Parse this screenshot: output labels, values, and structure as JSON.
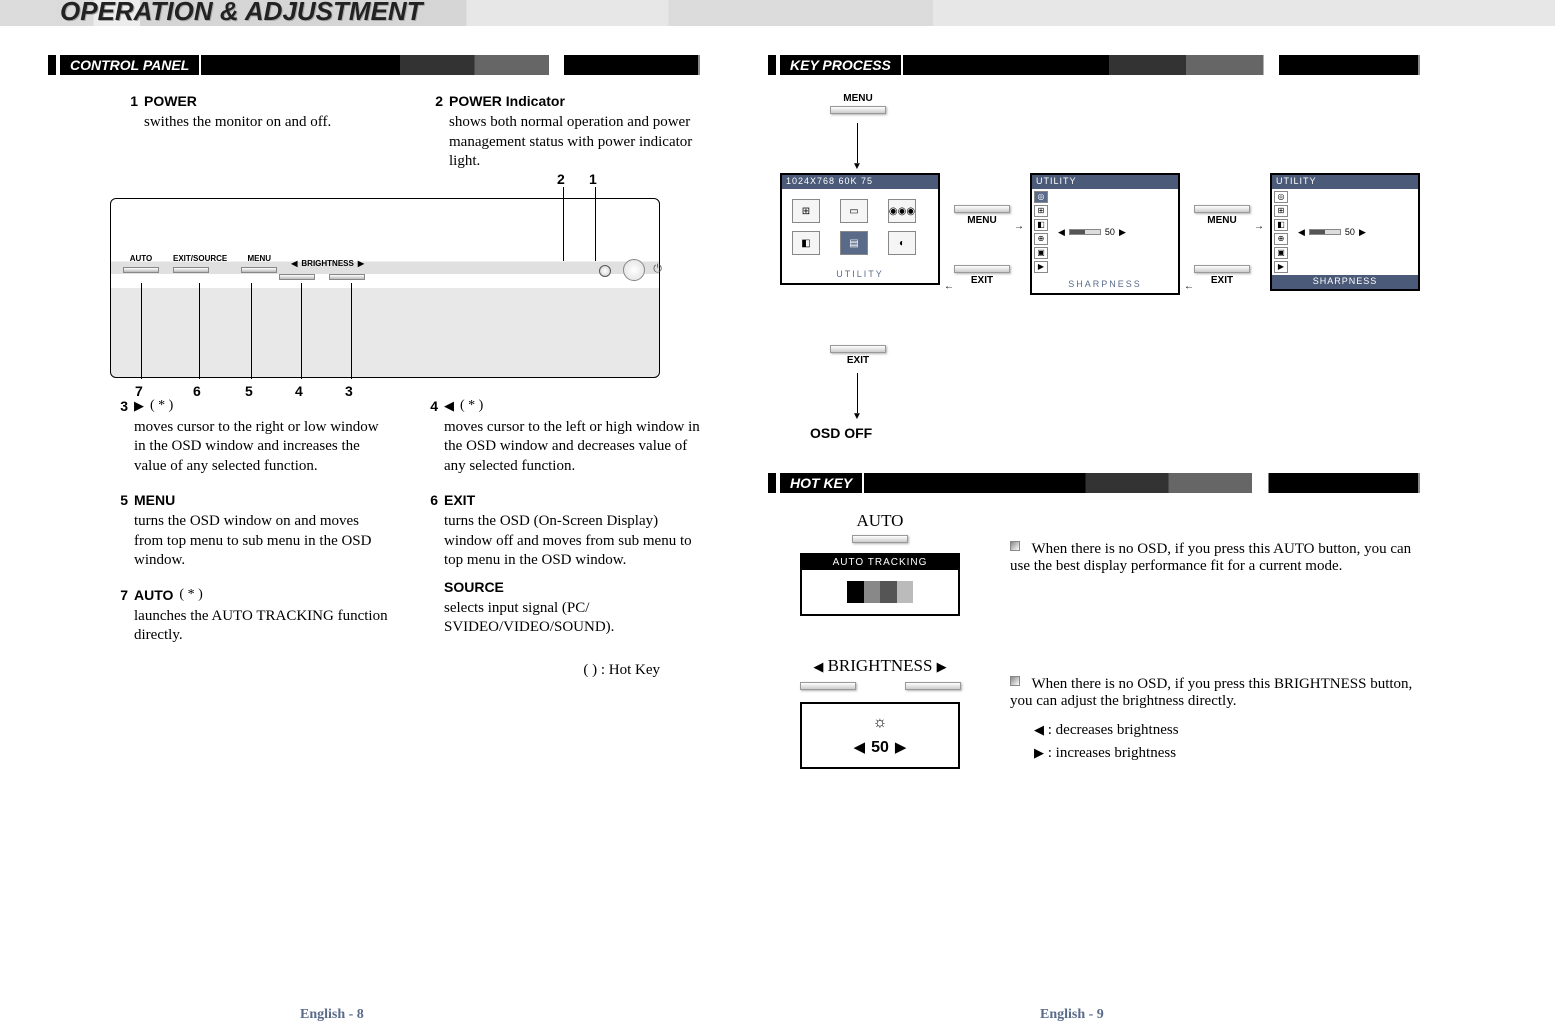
{
  "page": {
    "header_title": "OPERATION & ADJUSTMENT",
    "hotkey_note": "( ) : Hot Key",
    "star": "*"
  },
  "sections": {
    "control_panel": "CONTROL PANEL",
    "key_process": "KEY PROCESS",
    "hot_key": "HOT KEY"
  },
  "footer": {
    "left": "English - 8",
    "right": "English - 9"
  },
  "panel_labels": {
    "auto": "AUTO",
    "exit_source": "EXIT/SOURCE",
    "menu": "MENU",
    "brightness_left": "◀",
    "brightness": "BRIGHTNESS",
    "brightness_right": "▶"
  },
  "items": {
    "i1": {
      "num": "1",
      "title": "POWER",
      "desc": "swithes the monitor on and off."
    },
    "i2": {
      "num": "2",
      "title": "POWER Indicator",
      "desc": "shows both normal operation and power management status with power indicator light."
    },
    "i3": {
      "num": "3",
      "title_sym": "▶",
      "star": "( * )",
      "desc": "moves cursor to the right  or low window in the OSD window and  increases the value of any selected function."
    },
    "i4": {
      "num": "4",
      "title_sym": "◀",
      "star": "( * )",
      "desc": "moves cursor to the left or high window in the OSD window and  decreases value of any selected  function."
    },
    "i5": {
      "num": "5",
      "title": "MENU",
      "desc": "turns the OSD window on and moves from top menu to sub menu in the OSD window."
    },
    "i6": {
      "num": "6",
      "title": "EXIT",
      "desc": "turns the OSD (On-Screen Display) window off and moves from sub menu to top menu in the OSD window.",
      "title2": "SOURCE",
      "desc2": "selects input signal (PC/ SVIDEO/VIDEO/SOUND)."
    },
    "i7": {
      "num": "7",
      "title": "AUTO",
      "star": "( * )",
      "desc": "launches the AUTO TRACKING function directly."
    }
  },
  "osd": {
    "main_title": "1024X768      60K      75",
    "main_footer": "UTILITY",
    "utility_title": "UTILITY",
    "slider_value": "50",
    "sharpness": "SHARPNESS",
    "menu": "MENU",
    "exit": "EXIT",
    "osd_off": "OSD OFF"
  },
  "hotkey": {
    "auto_label": "AUTO",
    "auto_tracking": "AUTO TRACKING",
    "auto_desc": "When there is no OSD, if you press this AUTO button, you can use the best display performance fit  for a current mode.",
    "brightness_label": "BRIGHTNESS",
    "brightness_value": "50",
    "brightness_desc": "When there is no OSD, if you press this BRIGHTNESS button, you can adjust the brightness directly.",
    "dec": ":  decreases brightness",
    "inc": ":  increases brightness"
  }
}
